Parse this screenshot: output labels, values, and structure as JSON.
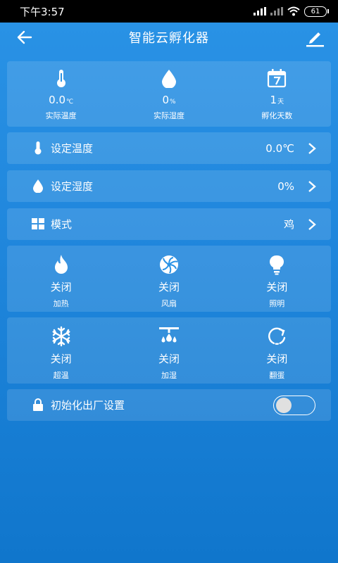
{
  "status_bar": {
    "time": "下午3:57",
    "battery": "61"
  },
  "header": {
    "title": "智能云孵化器"
  },
  "stats": [
    {
      "value": "0.0",
      "unit": "℃",
      "label": "实际温度",
      "icon": "thermometer-icon"
    },
    {
      "value": "0",
      "unit": "%",
      "label": "实际湿度",
      "icon": "droplet-icon"
    },
    {
      "value": "1",
      "unit": "天",
      "label": "孵化天数",
      "icon": "calendar-icon"
    }
  ],
  "set_temp": {
    "label": "设定温度",
    "value": "0.0℃"
  },
  "set_humidity": {
    "label": "设定湿度",
    "value": "0%"
  },
  "mode": {
    "label": "模式",
    "value": "鸡"
  },
  "controls_row1": [
    {
      "state": "关闭",
      "label": "加热",
      "icon": "flame-icon"
    },
    {
      "state": "关闭",
      "label": "风扇",
      "icon": "fan-icon"
    },
    {
      "state": "关闭",
      "label": "照明",
      "icon": "bulb-icon"
    }
  ],
  "controls_row2": [
    {
      "state": "关闭",
      "label": "超温",
      "icon": "snowflake-icon"
    },
    {
      "state": "关闭",
      "label": "加湿",
      "icon": "humidifier-icon"
    },
    {
      "state": "关闭",
      "label": "翻蛋",
      "icon": "rotate-icon"
    }
  ],
  "factory_reset": {
    "label": "初始化出厂设置",
    "enabled": false
  }
}
